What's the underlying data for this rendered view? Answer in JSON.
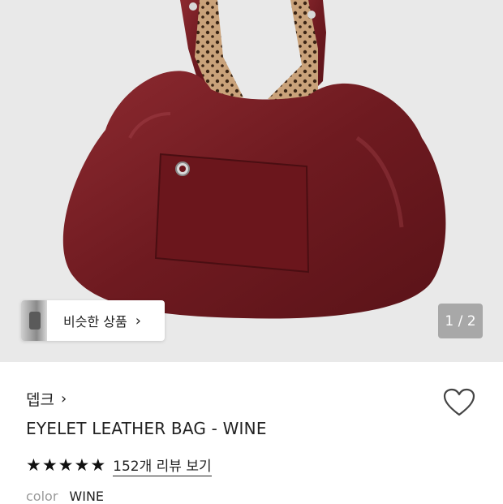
{
  "gallery": {
    "similar_label": "비슷한 상품",
    "similar_chevron": "›",
    "counter": "1 / 2"
  },
  "product": {
    "brand": "뎁크",
    "brand_chevron": "›",
    "title": "EYELET LEATHER BAG - WINE",
    "stars": [
      "★",
      "★",
      "★",
      "★",
      "★"
    ],
    "review_link": "152개 리뷰 보기",
    "color_label": "color",
    "color_value": "WINE"
  },
  "colors": {
    "bag": "#7a1c22",
    "gallery_bg": "#e9e9e9",
    "text": "#222222"
  },
  "icons": {
    "heart": "heart-icon",
    "chevron": "chevron-right-icon",
    "star": "star-icon"
  }
}
